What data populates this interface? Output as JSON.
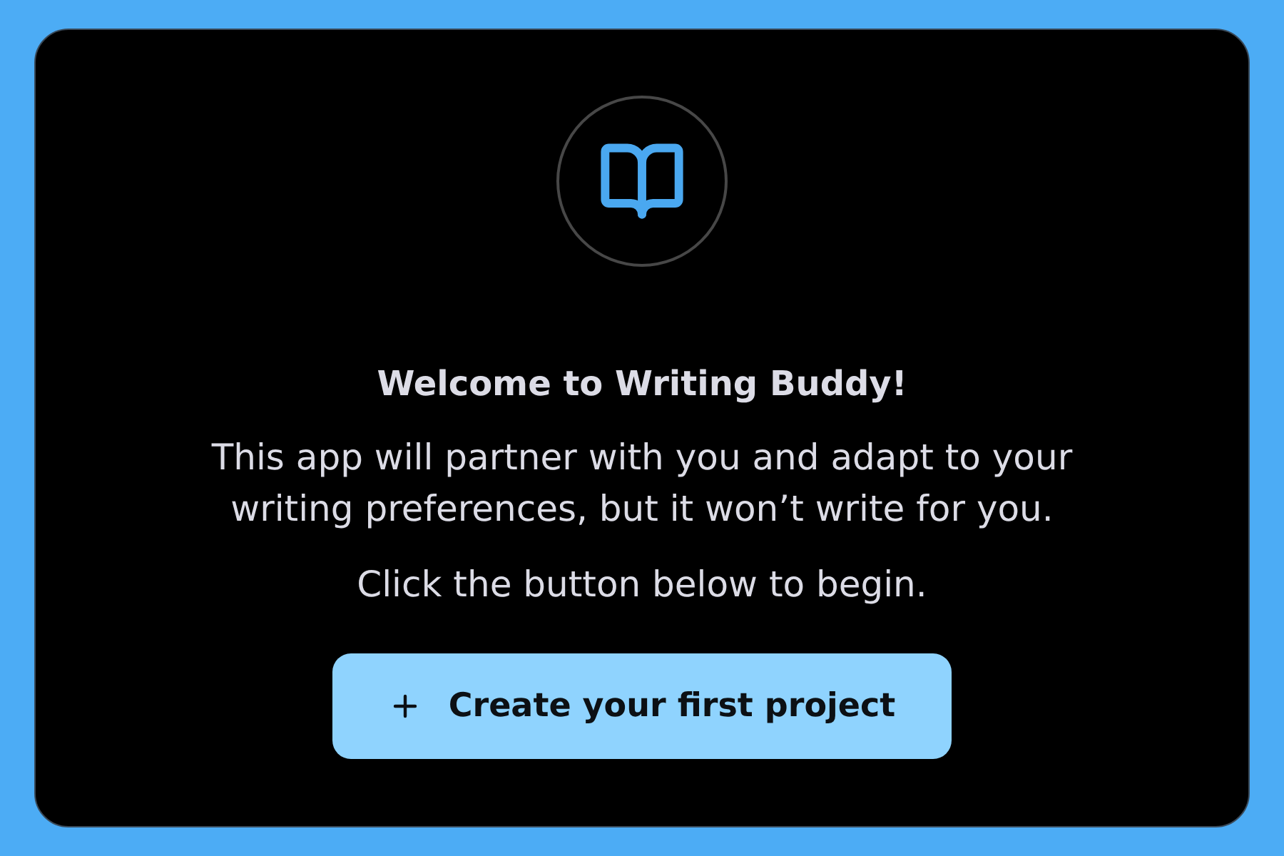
{
  "card": {
    "title": "Welcome to Writing Buddy!",
    "description": "This app will partner with you and adapt to your\nwriting preferences, but it won’t write for you.",
    "instruction": "Click the button below to begin.",
    "button": {
      "label": "Create your first project"
    }
  }
}
